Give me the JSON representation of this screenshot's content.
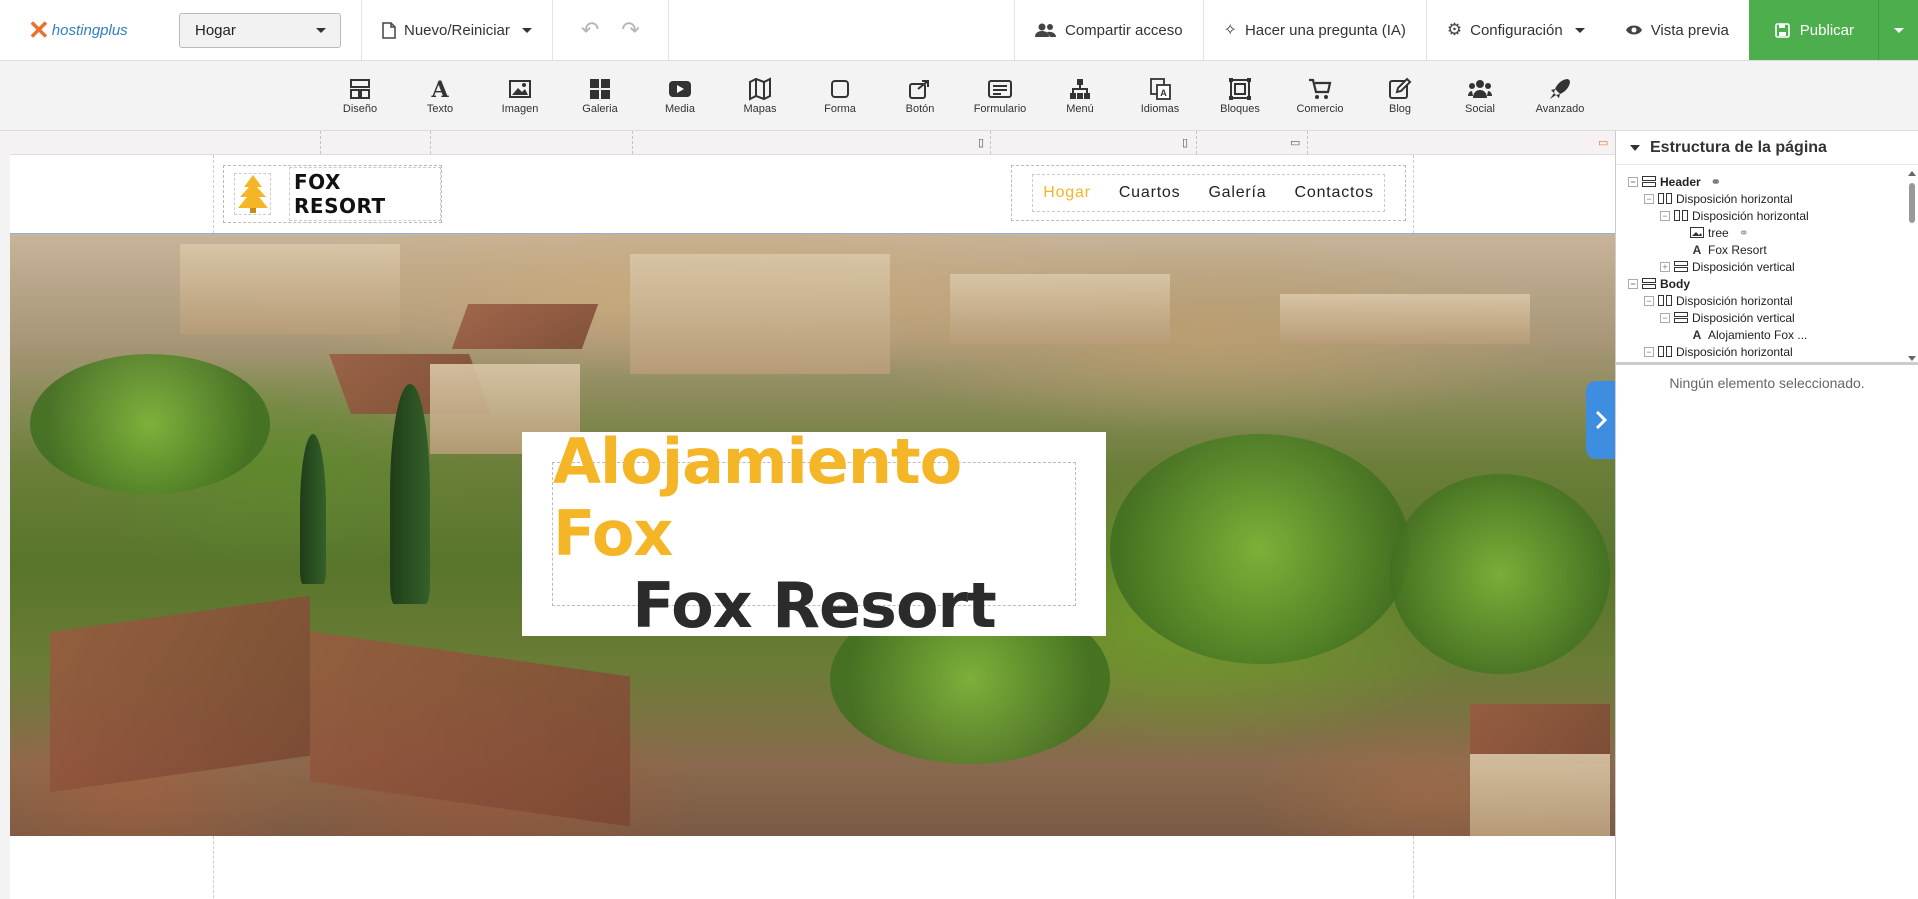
{
  "topbar": {
    "logo_text": "hostingplus",
    "page_select": "Hogar",
    "new_reset": "Nuevo/Reiniciar",
    "share": "Compartir acceso",
    "ask_ai": "Hacer una pregunta (IA)",
    "settings": "Configuración",
    "preview": "Vista previa",
    "publish": "Publicar"
  },
  "widgets": [
    {
      "label": "Diseño",
      "icon": "layout-icon"
    },
    {
      "label": "Texto",
      "icon": "text-icon"
    },
    {
      "label": "Imagen",
      "icon": "image-icon"
    },
    {
      "label": "Galeria",
      "icon": "gallery-icon"
    },
    {
      "label": "Media",
      "icon": "media-icon"
    },
    {
      "label": "Mapas",
      "icon": "map-icon"
    },
    {
      "label": "Forma",
      "icon": "shape-icon"
    },
    {
      "label": "Botón",
      "icon": "button-icon"
    },
    {
      "label": "Formulario",
      "icon": "form-icon"
    },
    {
      "label": "Menú",
      "icon": "menu-icon"
    },
    {
      "label": "Idiomas",
      "icon": "languages-icon"
    },
    {
      "label": "Bloques",
      "icon": "blocks-icon"
    },
    {
      "label": "Comercio",
      "icon": "cart-icon"
    },
    {
      "label": "Blog",
      "icon": "blog-icon"
    },
    {
      "label": "Social",
      "icon": "social-icon"
    },
    {
      "label": "Avanzado",
      "icon": "rocket-icon"
    }
  ],
  "site": {
    "brand": "FOX RESORT",
    "nav": [
      "Hogar",
      "Cuartos",
      "Galería",
      "Contactos"
    ],
    "hero_title": "Alojamiento Fox",
    "hero_subtitle": "Fox Resort"
  },
  "panel": {
    "title": "Estructura de la página",
    "tree": [
      {
        "label": "Header",
        "level": 0,
        "bold": true,
        "toggle": "⊟",
        "icon": "rows-icon"
      },
      {
        "label": "Disposición horizontal",
        "level": 1,
        "toggle": "⊟",
        "icon": "columns-icon"
      },
      {
        "label": "Disposición horizontal",
        "level": 2,
        "toggle": "⊟",
        "icon": "columns-icon"
      },
      {
        "label": "tree",
        "level": 3,
        "toggle": "",
        "icon": "image-icon"
      },
      {
        "label": "Fox Resort",
        "level": 3,
        "toggle": "",
        "icon": "text-icon"
      },
      {
        "label": "Disposición vertical",
        "level": 2,
        "toggle": "⊞",
        "icon": "rows-icon"
      },
      {
        "label": "Body",
        "level": 0,
        "bold": true,
        "toggle": "⊟",
        "icon": "rows-icon"
      },
      {
        "label": "Disposición horizontal",
        "level": 1,
        "toggle": "⊟",
        "icon": "columns-icon"
      },
      {
        "label": "Disposición vertical",
        "level": 2,
        "toggle": "⊟",
        "icon": "rows-icon"
      },
      {
        "label": "Alojamiento Fox ...",
        "level": 3,
        "toggle": "",
        "icon": "text-icon"
      },
      {
        "label": "Disposición horizontal",
        "level": 1,
        "toggle": "⊟",
        "icon": "columns-icon"
      }
    ],
    "no_selection": "Ningún elemento seleccionado."
  },
  "colors": {
    "accent": "#f4b526",
    "publish": "#4cae4c",
    "selection": "#3d8de0"
  }
}
